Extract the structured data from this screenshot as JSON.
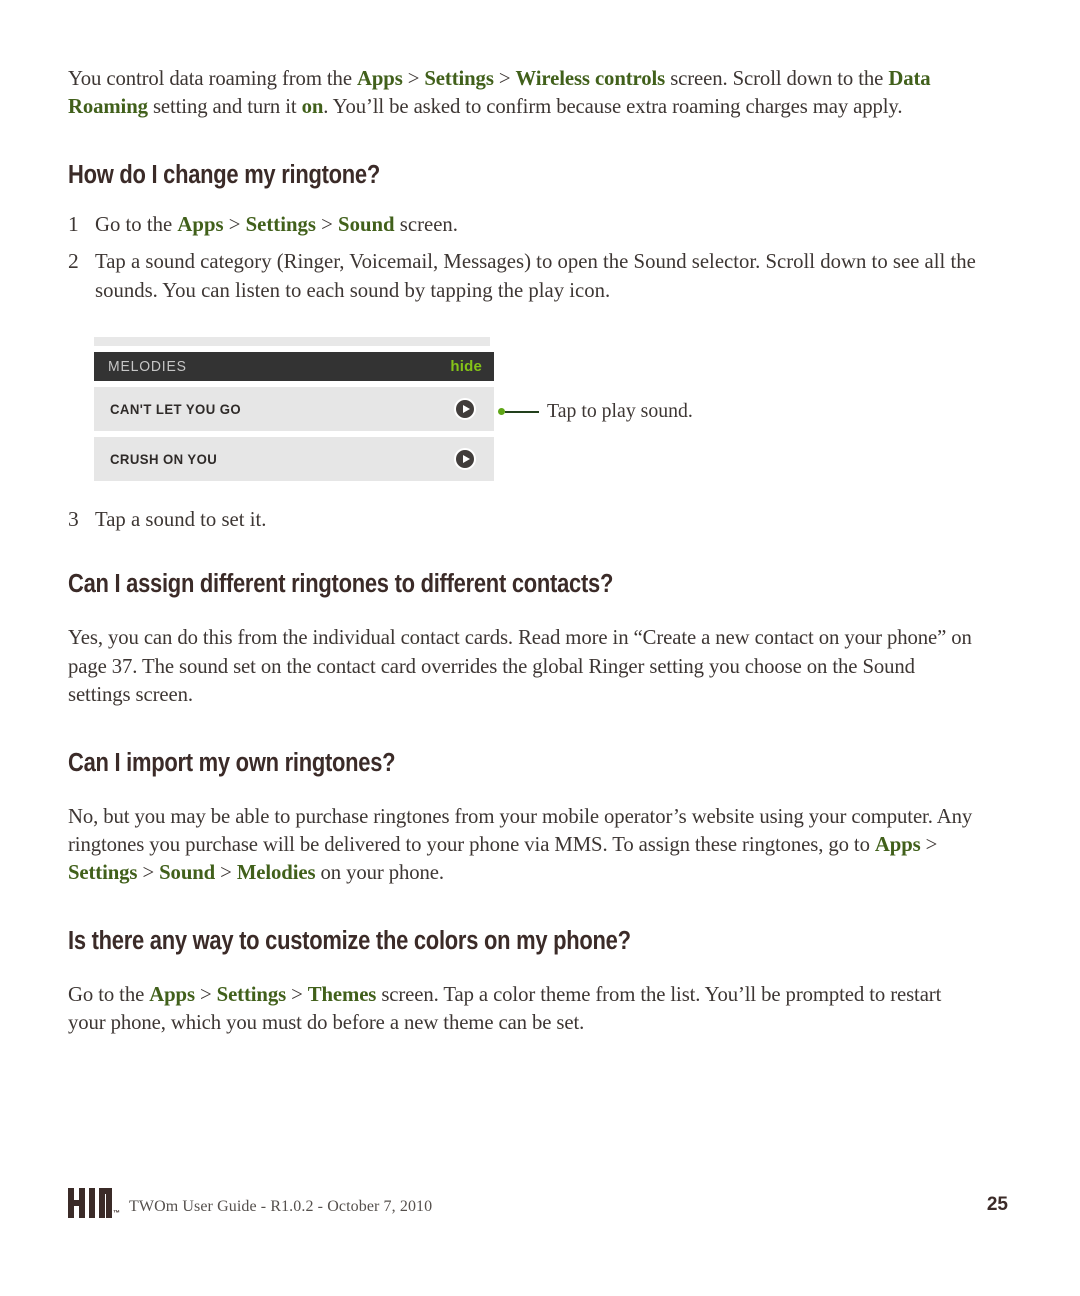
{
  "document": {
    "intro_paragraph": {
      "segments": [
        {
          "text": "You control data roaming from the ",
          "style": "normal"
        },
        {
          "text": "Apps",
          "style": "keyword"
        },
        {
          "text": " > ",
          "style": "chevron"
        },
        {
          "text": "Settings",
          "style": "keyword"
        },
        {
          "text": " > ",
          "style": "chevron"
        },
        {
          "text": "Wireless controls",
          "style": "keyword"
        },
        {
          "text": " screen. Scroll down to the ",
          "style": "normal"
        },
        {
          "text": "Data Roaming",
          "style": "keyword"
        },
        {
          "text": " setting and turn it ",
          "style": "normal"
        },
        {
          "text": "on",
          "style": "keyword"
        },
        {
          "text": ". You’ll be asked to confirm because extra roaming charges may apply.",
          "style": "normal"
        }
      ]
    },
    "sections": [
      {
        "heading": "How do I change my ringtone?",
        "steps": [
          {
            "number": "1",
            "segments": [
              {
                "text": "Go to the ",
                "style": "normal"
              },
              {
                "text": "Apps",
                "style": "keyword"
              },
              {
                "text": " > ",
                "style": "chevron"
              },
              {
                "text": "Settings",
                "style": "keyword"
              },
              {
                "text": " > ",
                "style": "chevron"
              },
              {
                "text": "Sound",
                "style": "keyword"
              },
              {
                "text": " screen.",
                "style": "normal"
              }
            ]
          },
          {
            "number": "2",
            "segments": [
              {
                "text": "Tap a sound category (Ringer, Voicemail, Messages) to open the Sound selector. Scroll down to see all the sounds. You can listen to each sound by tapping the play icon.",
                "style": "normal"
              }
            ]
          },
          {
            "number": "3",
            "segments": [
              {
                "text": "Tap a sound to set it.",
                "style": "normal"
              }
            ]
          }
        ]
      },
      {
        "heading": "Can I assign different ringtones to different contacts?",
        "paragraph": {
          "segments": [
            {
              "text": "Yes, you can do this from the individual contact cards. Read more in “Create a new contact on your phone” on page 37. The sound set on the contact card overrides the global Ringer setting you choose on the Sound settings screen.",
              "style": "normal"
            }
          ]
        }
      },
      {
        "heading": "Can I import my own ringtones?",
        "paragraph": {
          "segments": [
            {
              "text": "No, but you may be able to purchase ringtones from your mobile operator’s website using your computer. Any ringtones you purchase will be delivered to your phone via MMS. To assign these ringtones, go to ",
              "style": "normal"
            },
            {
              "text": "Apps",
              "style": "keyword"
            },
            {
              "text": " > ",
              "style": "chevron"
            },
            {
              "text": "Settings",
              "style": "keyword"
            },
            {
              "text": " > ",
              "style": "chevron"
            },
            {
              "text": "Sound",
              "style": "keyword"
            },
            {
              "text": " > ",
              "style": "chevron"
            },
            {
              "text": "Melodies",
              "style": "keyword"
            },
            {
              "text": " on your phone.",
              "style": "normal"
            }
          ]
        }
      },
      {
        "heading": "Is there any way to customize the colors on my phone?",
        "paragraph": {
          "segments": [
            {
              "text": "Go to the ",
              "style": "normal"
            },
            {
              "text": "Apps",
              "style": "keyword"
            },
            {
              "text": " > ",
              "style": "chevron"
            },
            {
              "text": "Settings",
              "style": "keyword"
            },
            {
              "text": " > ",
              "style": "chevron"
            },
            {
              "text": "Themes",
              "style": "keyword"
            },
            {
              "text": " screen. Tap a color theme from the list. You’ll be prompted to restart your phone, which you must do before a new theme can be set.",
              "style": "normal"
            }
          ]
        }
      }
    ]
  },
  "figure": {
    "header": {
      "title": "MELODIES",
      "hide_label": "hide"
    },
    "rows": [
      {
        "label": "CAN'T LET YOU GO",
        "play_icon": "play-icon"
      },
      {
        "label": "CRUSH ON YOU",
        "play_icon": "play-icon"
      }
    ],
    "callout": {
      "text": "Tap to play sound."
    },
    "colors": {
      "header_bg": "#333333",
      "header_title": "#c6c6c6",
      "hide_green": "#84c318",
      "row_bg": "#e6e6e6",
      "row_label": "#2e2a28",
      "play_button": "#413d3b",
      "callout_line": "#22401c",
      "callout_dot": "#5fa617",
      "scroll_hint": "#e8e8e8"
    }
  },
  "footer": {
    "logo_text": "KIN",
    "trademark": "™",
    "guide_text": "TWOm User Guide - R1.0.2 - October 7, 2010",
    "page_number": "25"
  },
  "theme": {
    "keyword_green": "#41601b",
    "body_text": "#3d3633",
    "heading_text": "#3b2b28",
    "page_background": "#ffffff"
  }
}
